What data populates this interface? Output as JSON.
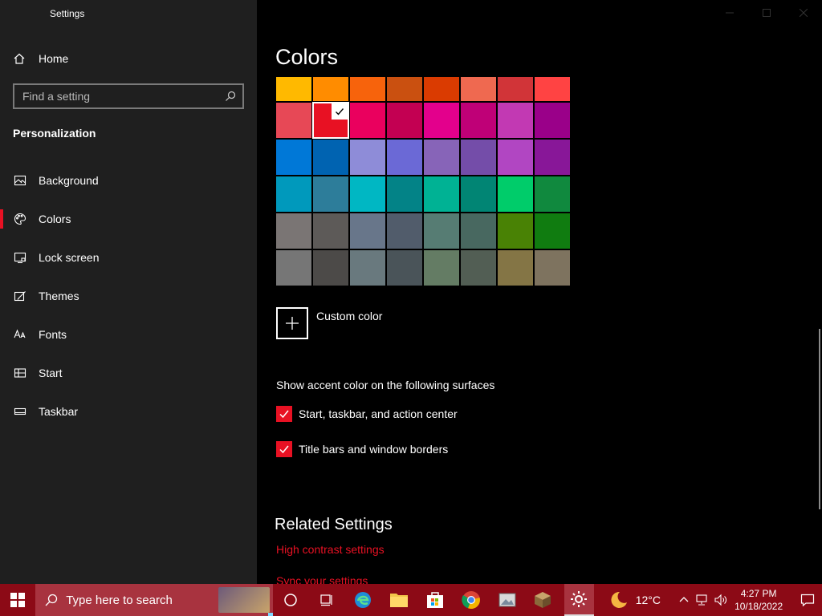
{
  "window": {
    "title": "Settings"
  },
  "sidebar": {
    "home_label": "Home",
    "search_placeholder": "Find a setting",
    "section_label": "Personalization",
    "items": [
      {
        "label": "Background",
        "icon": "image-icon"
      },
      {
        "label": "Colors",
        "icon": "palette-icon",
        "active": true
      },
      {
        "label": "Lock screen",
        "icon": "lock-screen-icon"
      },
      {
        "label": "Themes",
        "icon": "themes-icon"
      },
      {
        "label": "Fonts",
        "icon": "fonts-icon"
      },
      {
        "label": "Start",
        "icon": "start-icon"
      },
      {
        "label": "Taskbar",
        "icon": "taskbar-icon"
      }
    ]
  },
  "main": {
    "title": "Colors",
    "swatches": [
      [
        "#FFB900",
        "#FF8C00",
        "#F7630C",
        "#CA5010",
        "#DA3B01",
        "#EF6950",
        "#D13438",
        "#FF4343"
      ],
      [
        "#E74856",
        "#E81123",
        "#EA005E",
        "#C30052",
        "#E3008C",
        "#BF0077",
        "#C239B3",
        "#9A0089"
      ],
      [
        "#0078D7",
        "#0063B1",
        "#8E8CD8",
        "#6B69D6",
        "#8764B8",
        "#744DA9",
        "#B146C2",
        "#881798"
      ],
      [
        "#0099BC",
        "#2D7D9A",
        "#00B7C3",
        "#038387",
        "#00B294",
        "#018574",
        "#00CC6A",
        "#10893E"
      ],
      [
        "#7A7574",
        "#5D5A58",
        "#68768A",
        "#515C6B",
        "#567C73",
        "#486860",
        "#498205",
        "#107C10"
      ],
      [
        "#767676",
        "#4C4A48",
        "#69797E",
        "#4A5459",
        "#647C64",
        "#525E54",
        "#847545",
        "#7E735F"
      ]
    ],
    "selected_swatch": "#E81123",
    "custom_color_label": "Custom color",
    "surfaces_label": "Show accent color on the following surfaces",
    "surfaces": [
      {
        "label": "Start, taskbar, and action center",
        "checked": true
      },
      {
        "label": "Title bars and window borders",
        "checked": true
      }
    ],
    "related_title": "Related Settings",
    "related_links": [
      "High contrast settings",
      "Sync your settings"
    ]
  },
  "taskbar": {
    "search_placeholder": "Type here to search",
    "weather": "12°C",
    "time": "4:27 PM",
    "date": "10/18/2022"
  },
  "colors": {
    "accent": "#E81123",
    "taskbar": "#8C0A16",
    "sidebar": "#1F1F1F"
  }
}
